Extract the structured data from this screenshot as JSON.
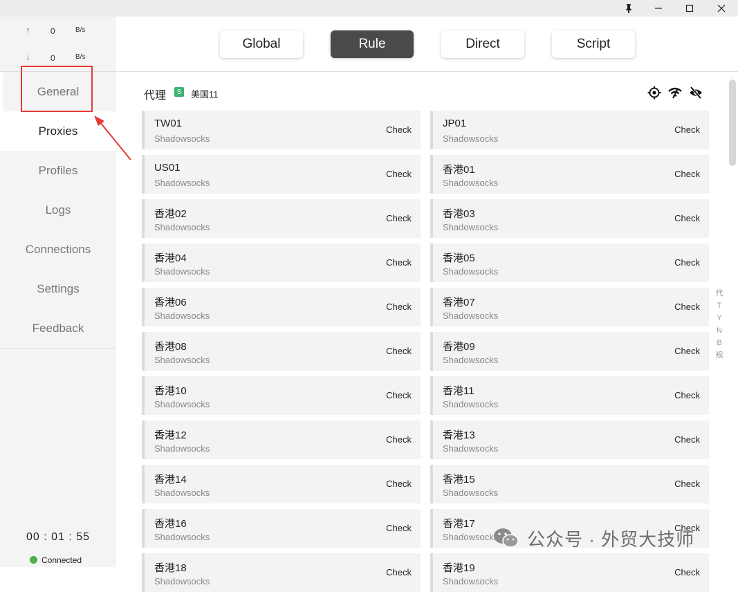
{
  "titlebar": {
    "pin_icon": "pin-icon",
    "minimize_icon": "minimize-icon",
    "maximize_icon": "maximize-icon",
    "close_icon": "close-icon"
  },
  "traffic": {
    "up": {
      "arrow": "↑",
      "value": "0",
      "unit": "B/s"
    },
    "down": {
      "arrow": "↓",
      "value": "0",
      "unit": "B/s"
    }
  },
  "sidebar": {
    "items": [
      {
        "label": "General"
      },
      {
        "label": "Proxies"
      },
      {
        "label": "Profiles"
      },
      {
        "label": "Logs"
      },
      {
        "label": "Connections"
      },
      {
        "label": "Settings"
      },
      {
        "label": "Feedback"
      }
    ],
    "active": "Proxies"
  },
  "footer": {
    "timer": "00 : 01 : 55",
    "status": "Connected",
    "status_color": "#4caf50"
  },
  "modes": {
    "items": [
      {
        "label": "Global"
      },
      {
        "label": "Rule"
      },
      {
        "label": "Direct"
      },
      {
        "label": "Script"
      }
    ],
    "active": "Rule"
  },
  "group": {
    "title": "代理",
    "badge": "S",
    "selected": "美国11",
    "icons": [
      "locate-icon",
      "speed-test-icon",
      "hide-icon"
    ]
  },
  "proxies": [
    {
      "name": "TW01",
      "type": "Shadowsocks",
      "action": "Check"
    },
    {
      "name": "JP01",
      "type": "Shadowsocks",
      "action": "Check"
    },
    {
      "name": "US01",
      "type": "Shadowsocks",
      "action": "Check"
    },
    {
      "name": "香港01",
      "type": "Shadowsocks",
      "action": "Check"
    },
    {
      "name": "香港02",
      "type": "Shadowsocks",
      "action": "Check"
    },
    {
      "name": "香港03",
      "type": "Shadowsocks",
      "action": "Check"
    },
    {
      "name": "香港04",
      "type": "Shadowsocks",
      "action": "Check"
    },
    {
      "name": "香港05",
      "type": "Shadowsocks",
      "action": "Check"
    },
    {
      "name": "香港06",
      "type": "Shadowsocks",
      "action": "Check"
    },
    {
      "name": "香港07",
      "type": "Shadowsocks",
      "action": "Check"
    },
    {
      "name": "香港08",
      "type": "Shadowsocks",
      "action": "Check"
    },
    {
      "name": "香港09",
      "type": "Shadowsocks",
      "action": "Check"
    },
    {
      "name": "香港10",
      "type": "Shadowsocks",
      "action": "Check"
    },
    {
      "name": "香港11",
      "type": "Shadowsocks",
      "action": "Check"
    },
    {
      "name": "香港12",
      "type": "Shadowsocks",
      "action": "Check"
    },
    {
      "name": "香港13",
      "type": "Shadowsocks",
      "action": "Check"
    },
    {
      "name": "香港14",
      "type": "Shadowsocks",
      "action": "Check"
    },
    {
      "name": "香港15",
      "type": "Shadowsocks",
      "action": "Check"
    },
    {
      "name": "香港16",
      "type": "Shadowsocks",
      "action": "Check"
    },
    {
      "name": "香港17",
      "type": "Shadowsocks",
      "action": "Check"
    },
    {
      "name": "香港18",
      "type": "Shadowsocks",
      "action": "Check"
    },
    {
      "name": "香港19",
      "type": "Shadowsocks",
      "action": "Check"
    }
  ],
  "side_index": [
    "代",
    "T",
    "Y",
    "N",
    "B",
    "规"
  ],
  "watermark": {
    "text": "公众号 · 外贸大技师"
  },
  "annotation": {
    "color": "#e53935"
  }
}
